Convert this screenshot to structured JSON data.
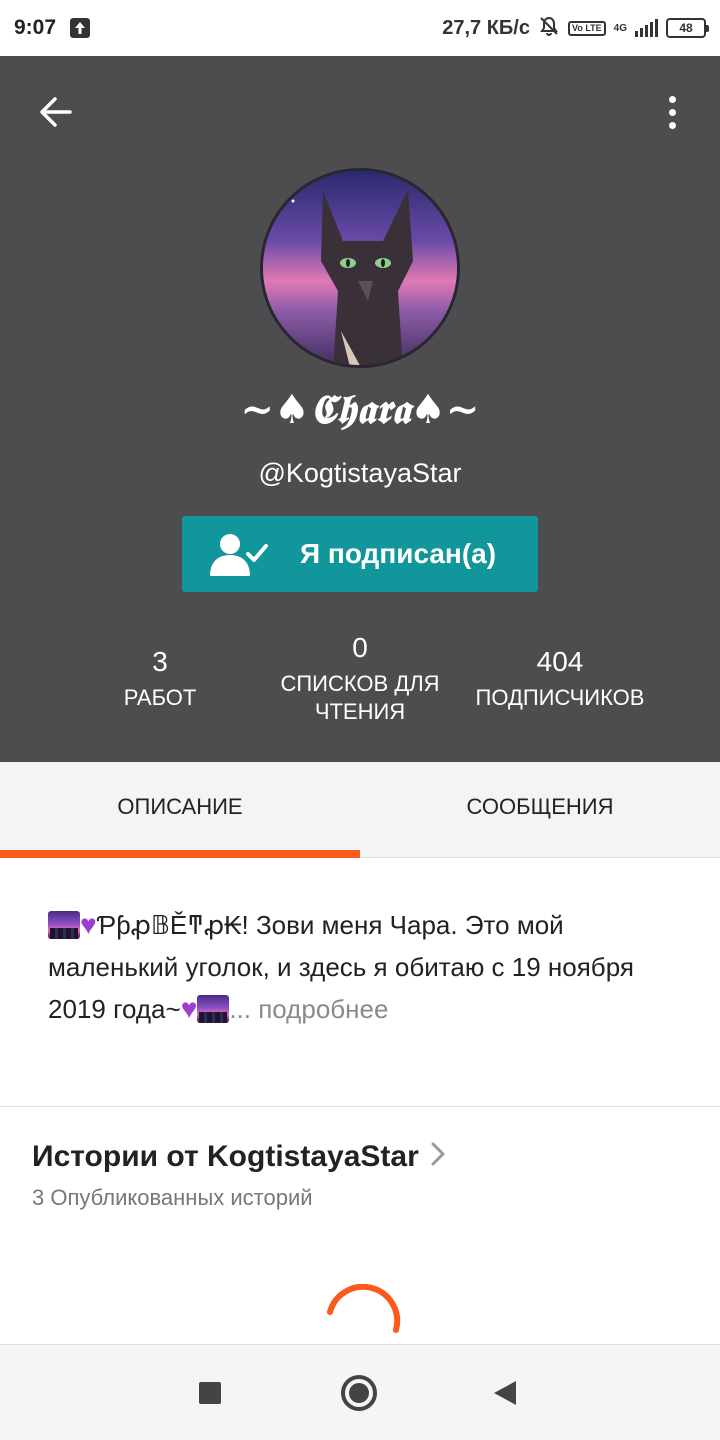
{
  "status_bar": {
    "time": "9:07",
    "speed": "27,7 КБ/с",
    "network": "4G",
    "volte": "Vo LTE",
    "battery": "48"
  },
  "profile": {
    "display_name": "~♠𝕮𝖍𝖆𝖗𝖆♠~",
    "username": "@KogtistayaStar",
    "follow_button_label": "Я подписан(а)"
  },
  "stats": {
    "works": {
      "value": "3",
      "label": "РАБОТ"
    },
    "reading_lists": {
      "value": "0",
      "label_line1": "СПИСКОВ ДЛЯ",
      "label_line2": "ЧТЕНИЯ"
    },
    "followers": {
      "value": "404",
      "label": "ПОДПИСЧИКОВ"
    }
  },
  "tabs": [
    {
      "label": "ОПИСАНИЕ",
      "active": true
    },
    {
      "label": "СООБЩЕНИЯ",
      "active": false
    }
  ],
  "description": {
    "greeting": "Ƥƥꝓ𝔹Ěͳꝓ₭!",
    "text": "Зови меня Чара. Это мой маленький уголок, и здесь я обитаю с 19 ноября 2019 года~",
    "ellipsis": "...",
    "more_link": "подробнее"
  },
  "stories": {
    "title": "Истории от KogtistayaStar",
    "subtitle": "3 Опубликованных историй"
  },
  "colors": {
    "header_bg": "#4d4c4e",
    "accent_teal": "#11979b",
    "accent_orange": "#fb5a1a"
  }
}
